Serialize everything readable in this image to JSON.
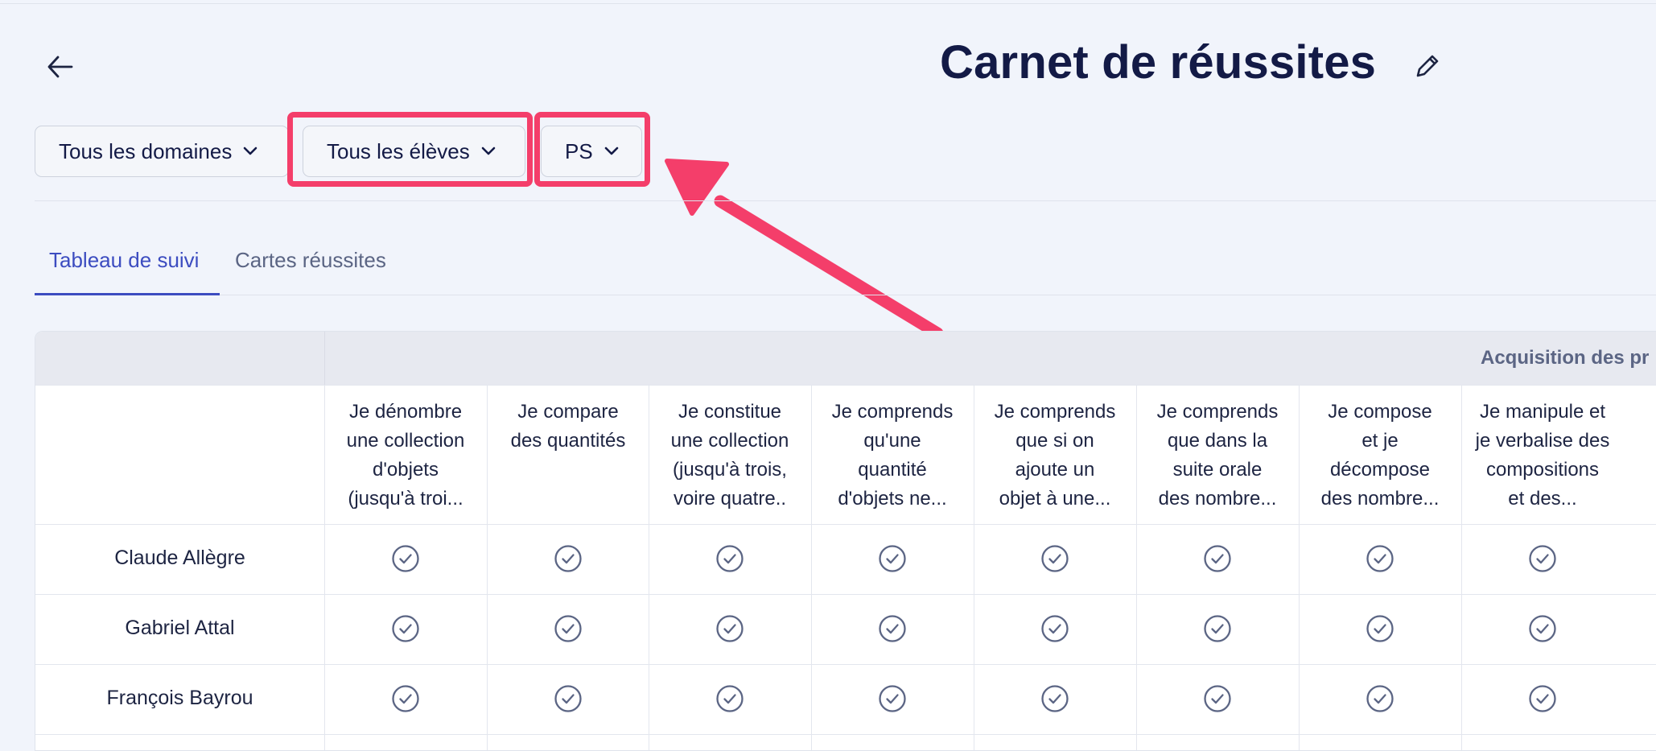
{
  "header": {
    "title": "Carnet de réussites"
  },
  "filters": {
    "domaines": "Tous les domaines",
    "eleves": "Tous les élèves",
    "niveau": "PS"
  },
  "tabs": [
    {
      "label": "Tableau de suivi",
      "active": true
    },
    {
      "label": "Cartes réussites",
      "active": false
    }
  ],
  "table": {
    "group_header": "Acquisition des pr",
    "columns": [
      [
        "Je dénombre",
        "une collection",
        "d'objets",
        "(jusqu'à troi..."
      ],
      [
        "Je compare",
        "des quantités"
      ],
      [
        "Je constitue",
        "une collection",
        "(jusqu'à trois,",
        "voire quatre.."
      ],
      [
        "Je comprends",
        "qu'une",
        "quantité",
        "d'objets ne..."
      ],
      [
        "Je comprends",
        "que si on",
        "ajoute un",
        "objet à une..."
      ],
      [
        "Je comprends",
        "que dans la",
        "suite orale",
        "des nombre..."
      ],
      [
        "Je compose",
        "et je",
        "décompose",
        "des nombre..."
      ],
      [
        "Je manipule et",
        "je verbalise des",
        "compositions",
        "et des..."
      ]
    ],
    "rows": [
      {
        "student": "Claude Allègre",
        "status": [
          "achieved",
          "achieved",
          "achieved",
          "achieved",
          "achieved",
          "achieved",
          "achieved",
          "achieved"
        ]
      },
      {
        "student": "Gabriel Attal",
        "status": [
          "achieved",
          "achieved",
          "achieved",
          "achieved",
          "achieved",
          "achieved",
          "achieved",
          "achieved"
        ]
      },
      {
        "student": "François Bayrou",
        "status": [
          "achieved",
          "achieved",
          "achieved",
          "achieved",
          "achieved",
          "achieved",
          "achieved",
          "achieved"
        ]
      }
    ]
  },
  "colors": {
    "accent": "#3c4cc0",
    "highlight": "#f43e6a",
    "title": "#131a46",
    "check_icon": "#5b6584"
  },
  "icons": {
    "back": "arrow-left-icon",
    "edit": "pencil-icon",
    "dropdown": "chevron-down-icon",
    "status": "check-circle-icon"
  }
}
